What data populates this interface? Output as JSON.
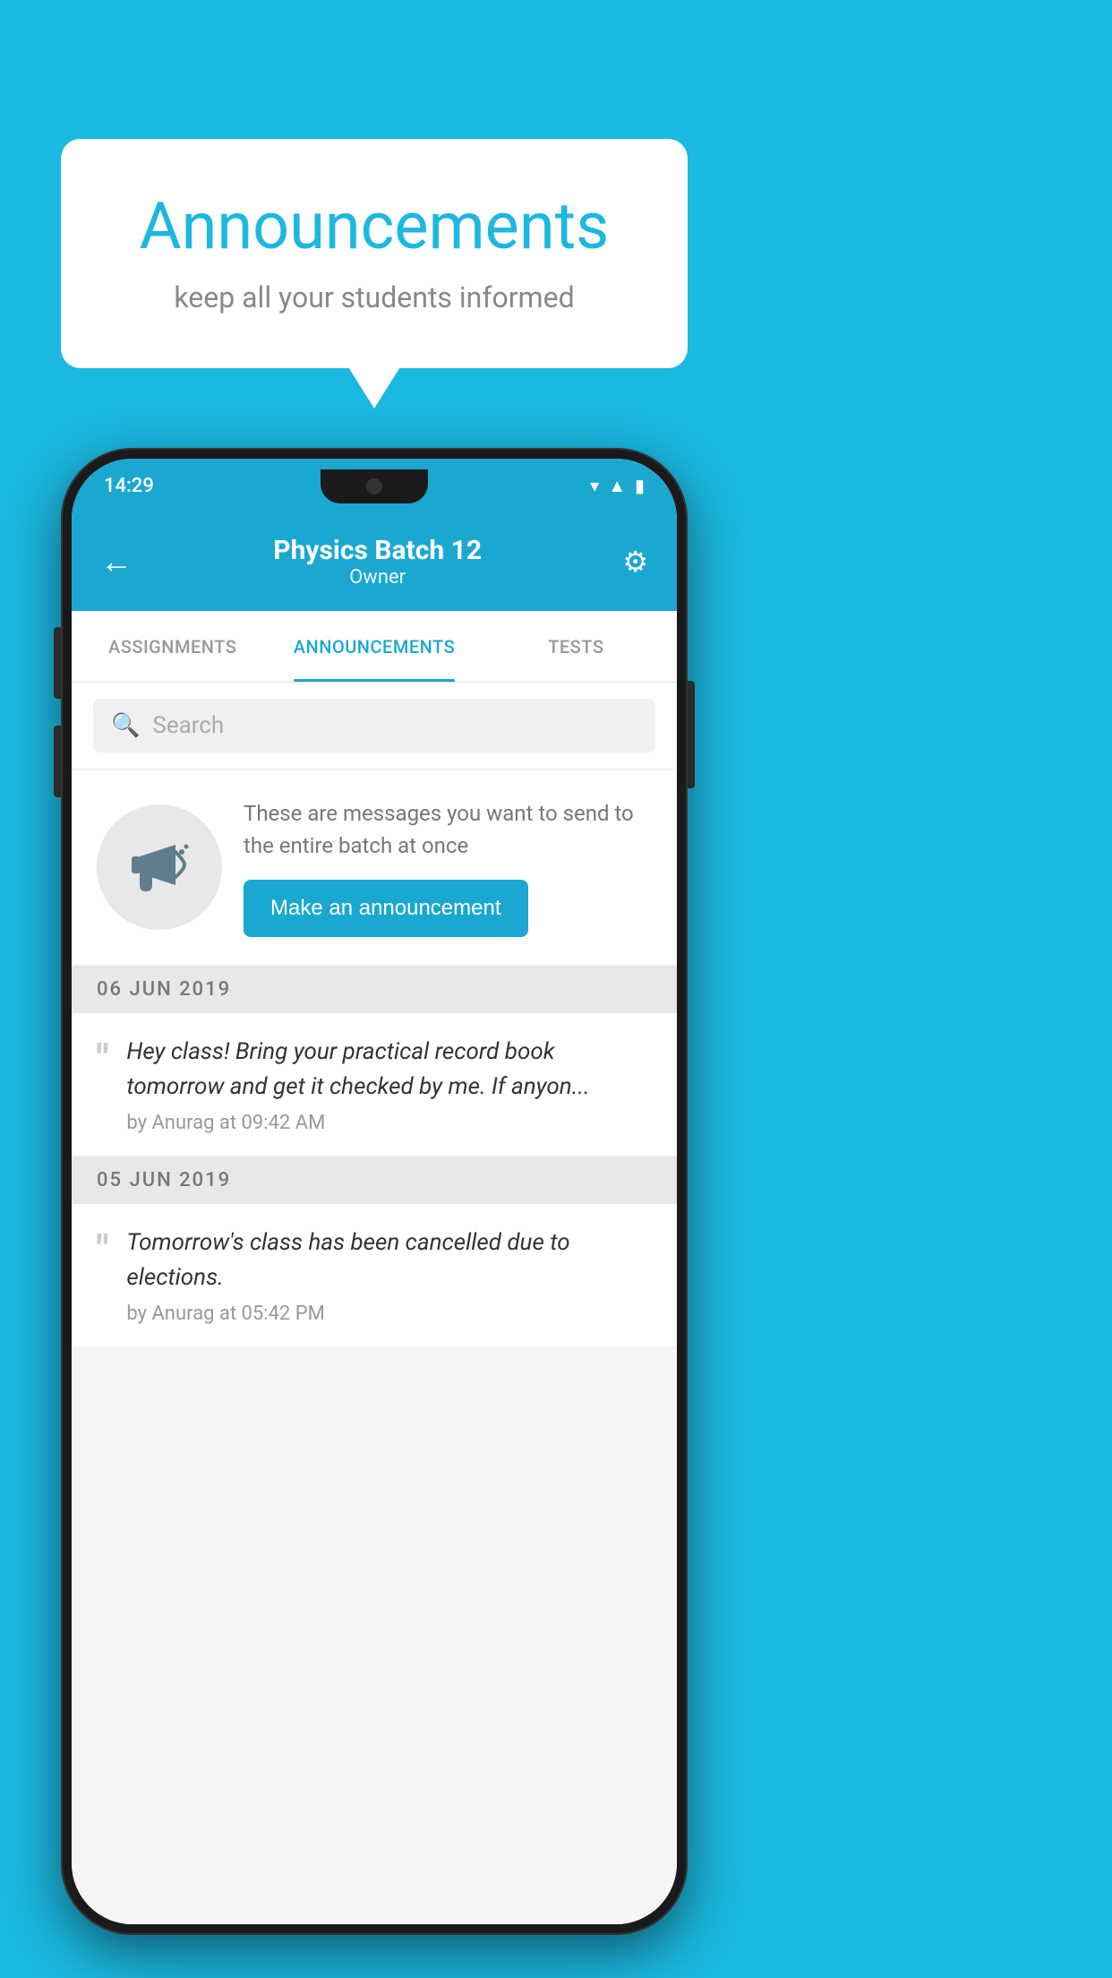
{
  "app": {
    "background_color": "#1BB8E0"
  },
  "speech_bubble": {
    "title": "Announcements",
    "subtitle": "keep all your students informed"
  },
  "status_bar": {
    "time": "14:29",
    "wifi": "▾",
    "signal": "▲",
    "battery": "▮"
  },
  "header": {
    "back_icon": "←",
    "title": "Physics Batch 12",
    "subtitle": "Owner",
    "gear_icon": "⚙"
  },
  "tabs": [
    {
      "label": "ASSIGNMENTS",
      "active": false
    },
    {
      "label": "ANNOUNCEMENTS",
      "active": true
    },
    {
      "label": "TESTS",
      "active": false
    }
  ],
  "search": {
    "placeholder": "Search",
    "icon": "🔍"
  },
  "announcement_empty_state": {
    "description": "These are messages you want to send to the entire batch at once",
    "button_label": "Make an announcement"
  },
  "date_groups": [
    {
      "date_label": "06  JUN  2019",
      "messages": [
        {
          "text": "Hey class! Bring your practical record book tomorrow and get it checked by me. If anyon...",
          "author": "by Anurag at 09:42 AM"
        }
      ]
    },
    {
      "date_label": "05  JUN  2019",
      "messages": [
        {
          "text": "Tomorrow's class has been cancelled due to elections.",
          "author": "by Anurag at 05:42 PM"
        }
      ]
    }
  ]
}
